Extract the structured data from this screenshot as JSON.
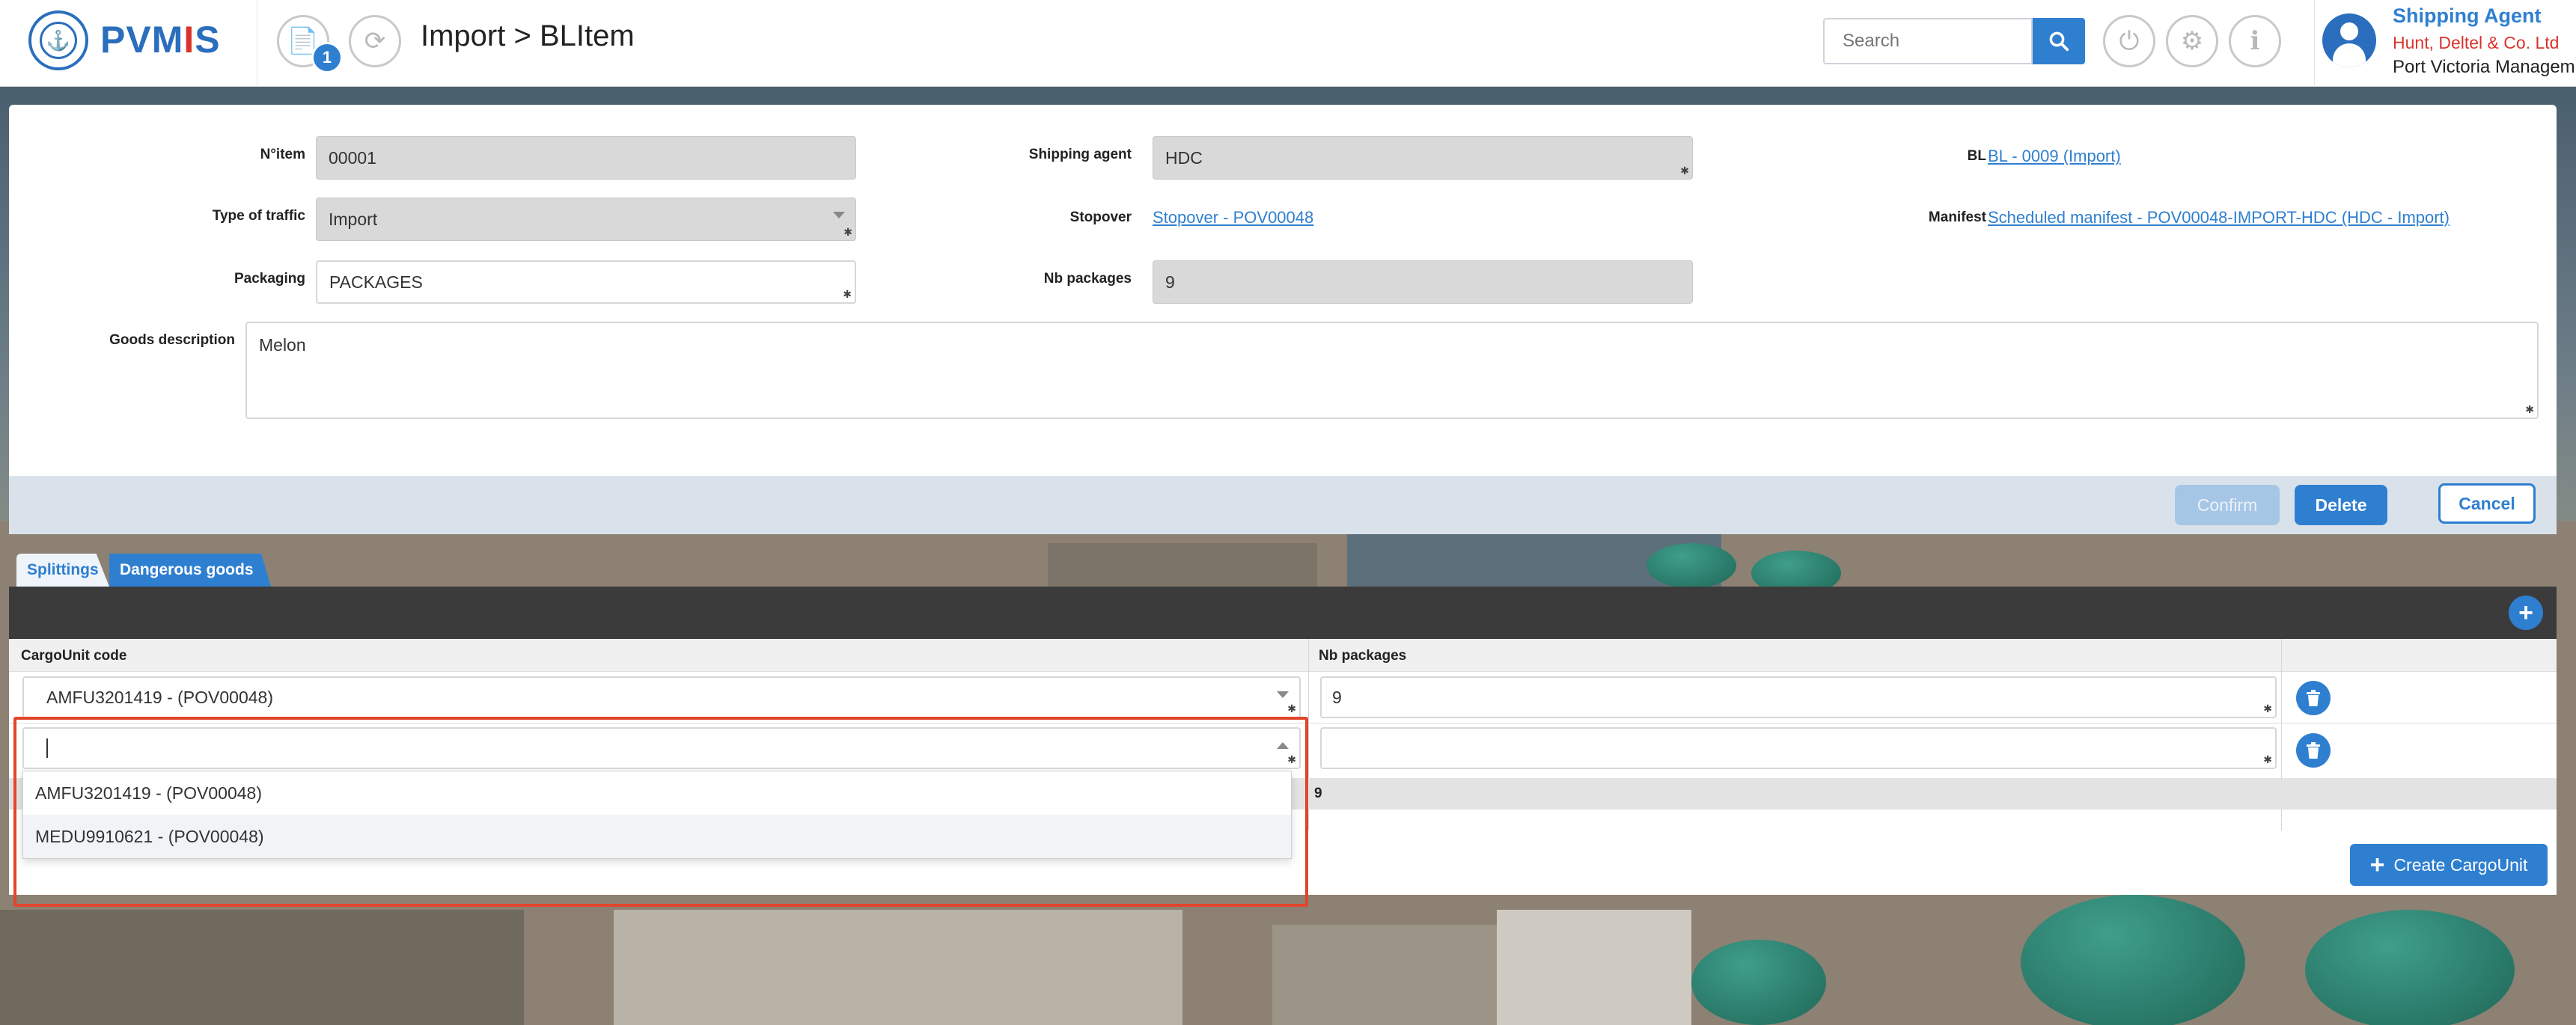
{
  "app": {
    "logo_text": "PVMIS"
  },
  "header": {
    "notification_count": "1",
    "page_title": "Import > BLItem",
    "search_placeholder": "Search"
  },
  "user": {
    "role": "Shipping Agent",
    "company": "Hunt, Deltel & Co. Ltd",
    "org": "Port Victoria Managem"
  },
  "form": {
    "n_item_label": "N°item",
    "n_item_value": "00001",
    "type_of_traffic_label": "Type of traffic",
    "type_of_traffic_value": "Import",
    "packaging_label": "Packaging",
    "packaging_value": "PACKAGES",
    "goods_description_label": "Goods description",
    "goods_description_value": "Melon",
    "shipping_agent_label": "Shipping agent",
    "shipping_agent_value": "HDC",
    "stopover_label": "Stopover",
    "stopover_value": "Stopover - POV00048",
    "nb_packages_label": "Nb packages",
    "nb_packages_value": "9",
    "bl_label": "BL",
    "bl_value": "BL - 0009 (Import)",
    "manifest_label": "Manifest",
    "manifest_value": "Scheduled manifest - POV00048-IMPORT-HDC (HDC - Import)"
  },
  "actions": {
    "confirm": "Confirm",
    "delete": "Delete",
    "cancel": "Cancel"
  },
  "tabs": [
    "Splittings",
    "Dangerous goods"
  ],
  "grid": {
    "columns": [
      "CargoUnit code",
      "Nb packages"
    ],
    "rows": [
      {
        "cargo_unit": "AMFU3201419 - (POV00048)",
        "nb_packages": "9"
      },
      {
        "cargo_unit": "",
        "nb_packages": ""
      }
    ],
    "total_nb_packages": "9",
    "create_button": "Create CargoUnit"
  },
  "dropdown": {
    "options": [
      "AMFU3201419 - (POV00048)",
      "MEDU9910621 - (POV00048)"
    ],
    "hovered_index": 1
  },
  "colors": {
    "primary": "#2f7fd0",
    "brand_red": "#d9342b",
    "grid_bar": "#3b3b3b",
    "highlight": "#e2452d"
  }
}
